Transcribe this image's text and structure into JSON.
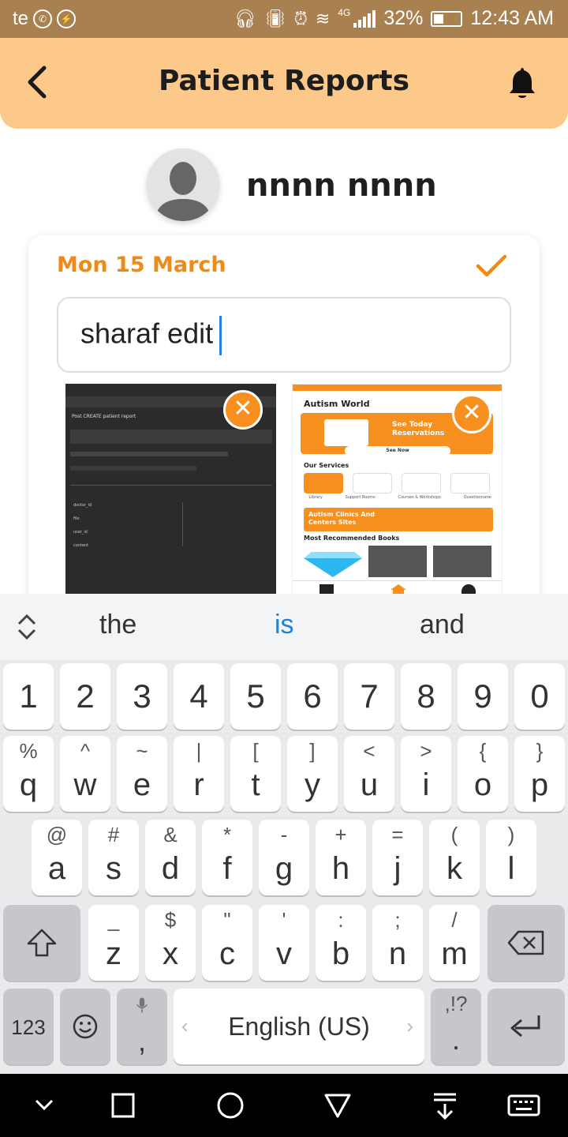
{
  "status_bar": {
    "carrier": "te",
    "network": "4G",
    "battery": "32%",
    "time": "12:43 AM"
  },
  "header": {
    "title": "Patient Reports"
  },
  "patient": {
    "name": "nnnn nnnn"
  },
  "report": {
    "date": "Mon 15 March",
    "note_value": "sharaf edit"
  },
  "attachments": [
    {
      "name": "screenshot-post-create-patient-report",
      "header_text": "Post CREATE patient report",
      "rows": [
        "doctor_id",
        "file",
        "user_id",
        "content"
      ]
    },
    {
      "name": "screenshot-autism-world-app",
      "app_title": "Autism World",
      "banner_text": "See Today Reservations",
      "see_now": "See Now",
      "our_services": "Our Services",
      "services": [
        "Library",
        "Support Rooms",
        "Courses & Workshops",
        "Questionnaire"
      ],
      "clinics": "Autism Clinics And Centers Sites",
      "books": "Most Recommended Books"
    }
  ],
  "keyboard": {
    "suggestions": [
      "the",
      "is",
      "and"
    ],
    "suggestion_colors": {
      "normal": "#333333",
      "highlight": "#1f7fe0"
    },
    "number_row": [
      "1",
      "2",
      "3",
      "4",
      "5",
      "6",
      "7",
      "8",
      "9",
      "0"
    ],
    "row1": [
      {
        "main": "q",
        "sub": "%"
      },
      {
        "main": "w",
        "sub": "^"
      },
      {
        "main": "e",
        "sub": "~"
      },
      {
        "main": "r",
        "sub": "|"
      },
      {
        "main": "t",
        "sub": "["
      },
      {
        "main": "y",
        "sub": "]"
      },
      {
        "main": "u",
        "sub": "<"
      },
      {
        "main": "i",
        "sub": ">"
      },
      {
        "main": "o",
        "sub": "{"
      },
      {
        "main": "p",
        "sub": "}"
      }
    ],
    "row2": [
      {
        "main": "a",
        "sub": "@"
      },
      {
        "main": "s",
        "sub": "#"
      },
      {
        "main": "d",
        "sub": "&"
      },
      {
        "main": "f",
        "sub": "*"
      },
      {
        "main": "g",
        "sub": "-"
      },
      {
        "main": "h",
        "sub": "+"
      },
      {
        "main": "j",
        "sub": "="
      },
      {
        "main": "k",
        "sub": "("
      },
      {
        "main": "l",
        "sub": ")"
      }
    ],
    "row3": [
      {
        "main": "z",
        "sub": "_"
      },
      {
        "main": "x",
        "sub": "$"
      },
      {
        "main": "c",
        "sub": "\""
      },
      {
        "main": "v",
        "sub": "'"
      },
      {
        "main": "b",
        "sub": ":"
      },
      {
        "main": "n",
        "sub": ";"
      },
      {
        "main": "m",
        "sub": "/"
      }
    ],
    "symbols_key": "123",
    "comma_key": ",",
    "space_label": "English (US)",
    "period_key": ".",
    "period_sub": ",!?"
  },
  "colors": {
    "status_bar": "#a98151",
    "header": "#fdc98a",
    "accent_orange": "#f08a14",
    "close_button": "#f7901e",
    "caret": "#2a7ee8"
  }
}
